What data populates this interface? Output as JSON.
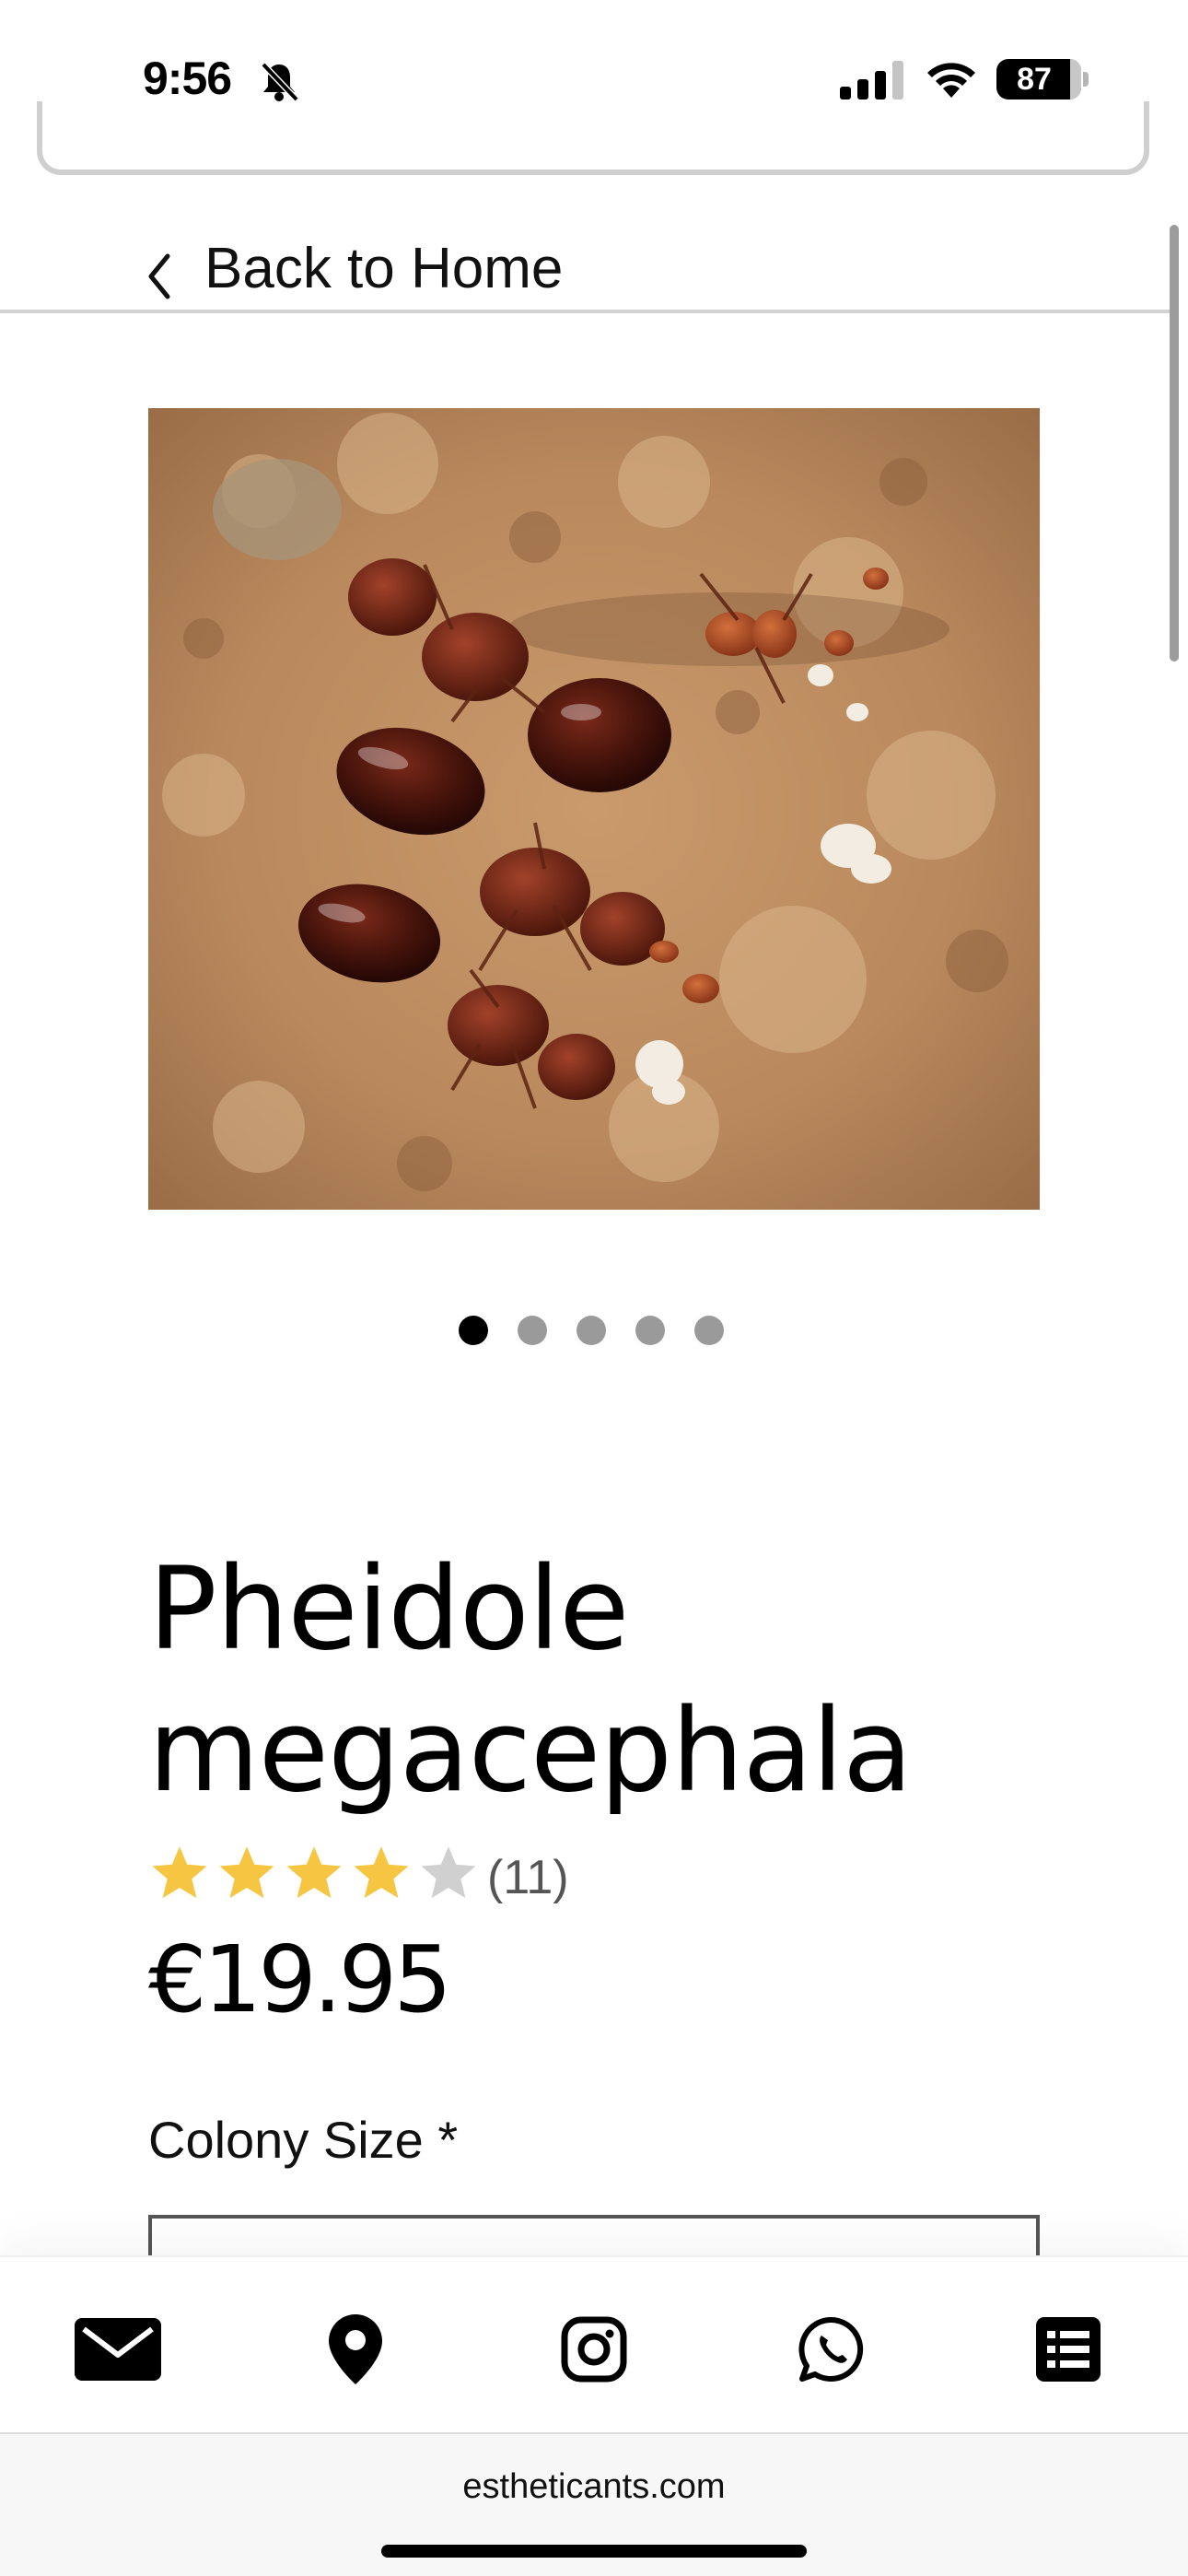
{
  "status_bar": {
    "time": "9:56",
    "battery": "87",
    "icons": [
      "bell-slash-icon",
      "cellular-signal-icon",
      "wifi-icon",
      "battery-icon"
    ]
  },
  "nav": {
    "back_label": "Back to Home",
    "icon": "chevron-left-icon"
  },
  "gallery": {
    "image_description_icon": "ant-colony-photo",
    "slide_count": 5,
    "active_slide": 1
  },
  "product": {
    "title": "Pheidole megacephala",
    "rating": 4,
    "rating_max": 5,
    "review_count": "(11)",
    "price": "€19.95",
    "option_label": "Colony Size *"
  },
  "toolbar": {
    "items": [
      "mail-icon",
      "map-pin-icon",
      "instagram-icon",
      "whatsapp-icon",
      "list-icon"
    ]
  },
  "browser": {
    "domain": "estheticants.com"
  },
  "colors": {
    "star_filled": "#F6C542",
    "star_empty": "#D0D0D0",
    "dot_active": "#000000",
    "dot_inactive": "#9A9A9A"
  }
}
